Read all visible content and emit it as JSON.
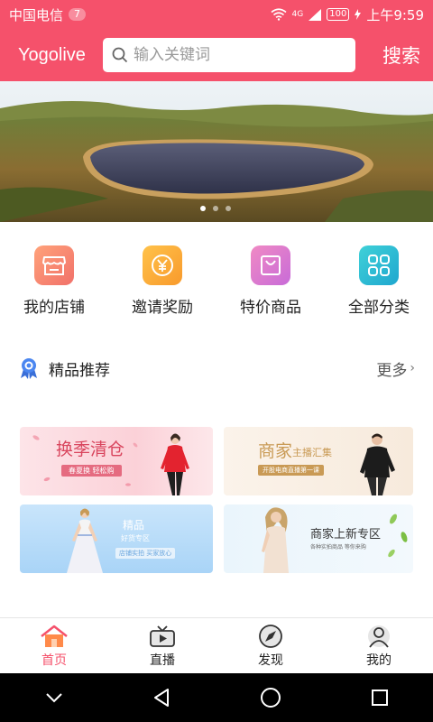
{
  "status_bar": {
    "carrier": "中国电信",
    "notification_count": "7",
    "network": "4G",
    "battery": "100",
    "time": "上午9:59"
  },
  "header": {
    "brand": "Yogolive",
    "search_placeholder": "输入关键词",
    "search_button": "搜索"
  },
  "banner": {
    "slide_count": 3,
    "active_slide": 1
  },
  "quick_entries": [
    {
      "label": "我的店铺",
      "icon": "store-icon",
      "color": "#f68a6b"
    },
    {
      "label": "邀请奖励",
      "icon": "yen-coin-icon",
      "color": "#fbaa3c"
    },
    {
      "label": "特价商品",
      "icon": "shopping-bag-icon",
      "color": "#e573c0"
    },
    {
      "label": "全部分类",
      "icon": "grid-icon",
      "color": "#2bbcd4"
    }
  ],
  "section": {
    "title": "精品推荐",
    "more": "更多",
    "icon": "award-ribbon-icon"
  },
  "promos": [
    {
      "title": "换季清仓",
      "subtitle": "春夏换 轻松购"
    },
    {
      "title": "商家",
      "title2": "主播汇集",
      "subtitle": "开股电商直播第一课"
    },
    {
      "title": "精品",
      "title2": "好货专区",
      "subtitle": "店铺实拍 买家放心"
    },
    {
      "title": "商家上新专区",
      "subtitle": "各种实拍商品 等你来购"
    }
  ],
  "tabs": [
    {
      "label": "首页",
      "icon": "home-icon",
      "active": true
    },
    {
      "label": "直播",
      "icon": "tv-icon",
      "active": false
    },
    {
      "label": "发现",
      "icon": "compass-icon",
      "active": false
    },
    {
      "label": "我的",
      "icon": "user-icon",
      "active": false
    }
  ],
  "colors": {
    "brand": "#f5516b",
    "active_tab": "#f5516b"
  }
}
